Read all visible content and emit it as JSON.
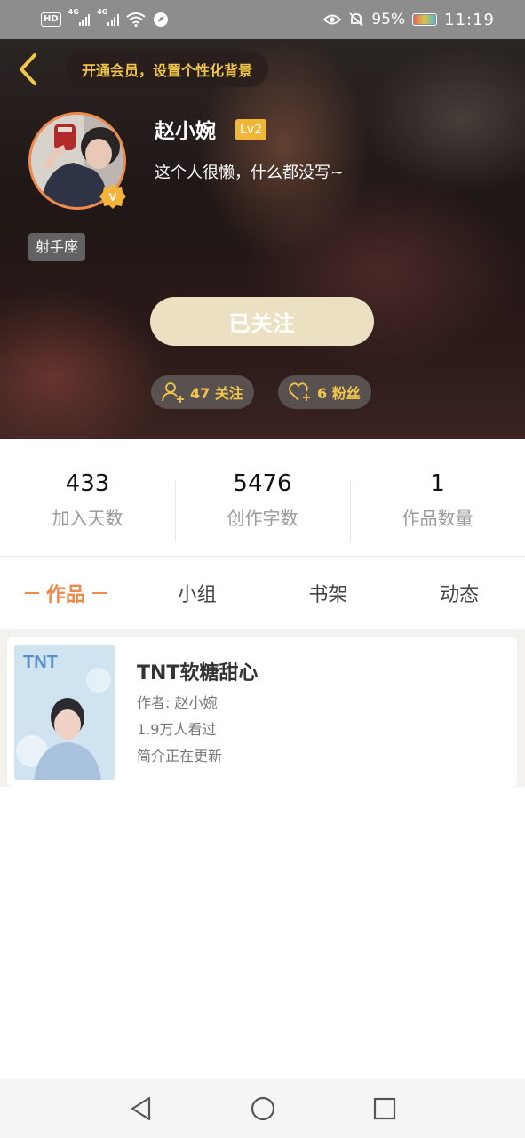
{
  "status_bar": {
    "hd": "HD",
    "net1": "4G",
    "net2": "4G",
    "battery": "95%",
    "time": "11:19"
  },
  "header": {
    "vip_banner": "开通会员，设置个性化背景",
    "name": "赵小婉",
    "level": "Lv2",
    "bio": "这个人很懒，什么都没写~",
    "zodiac": "射手座",
    "follow_button": "已关注",
    "following": "47 关注",
    "fans": "6 粉丝"
  },
  "stats": [
    {
      "value": "433",
      "label": "加入天数"
    },
    {
      "value": "5476",
      "label": "创作字数"
    },
    {
      "value": "1",
      "label": "作品数量"
    }
  ],
  "tabs": [
    "作品",
    "小组",
    "书架",
    "动态"
  ],
  "works": [
    {
      "title": "TNT软糖甜心",
      "author": "作者: 赵小婉",
      "views": "1.9万人看过",
      "intro": "简介正在更新",
      "cover_text": "TNT"
    }
  ],
  "colors": {
    "accent": "#ee8a4c",
    "gold": "#f2c64a",
    "level_badge": "#f0b63a",
    "follow_button": "#ece0c2"
  }
}
